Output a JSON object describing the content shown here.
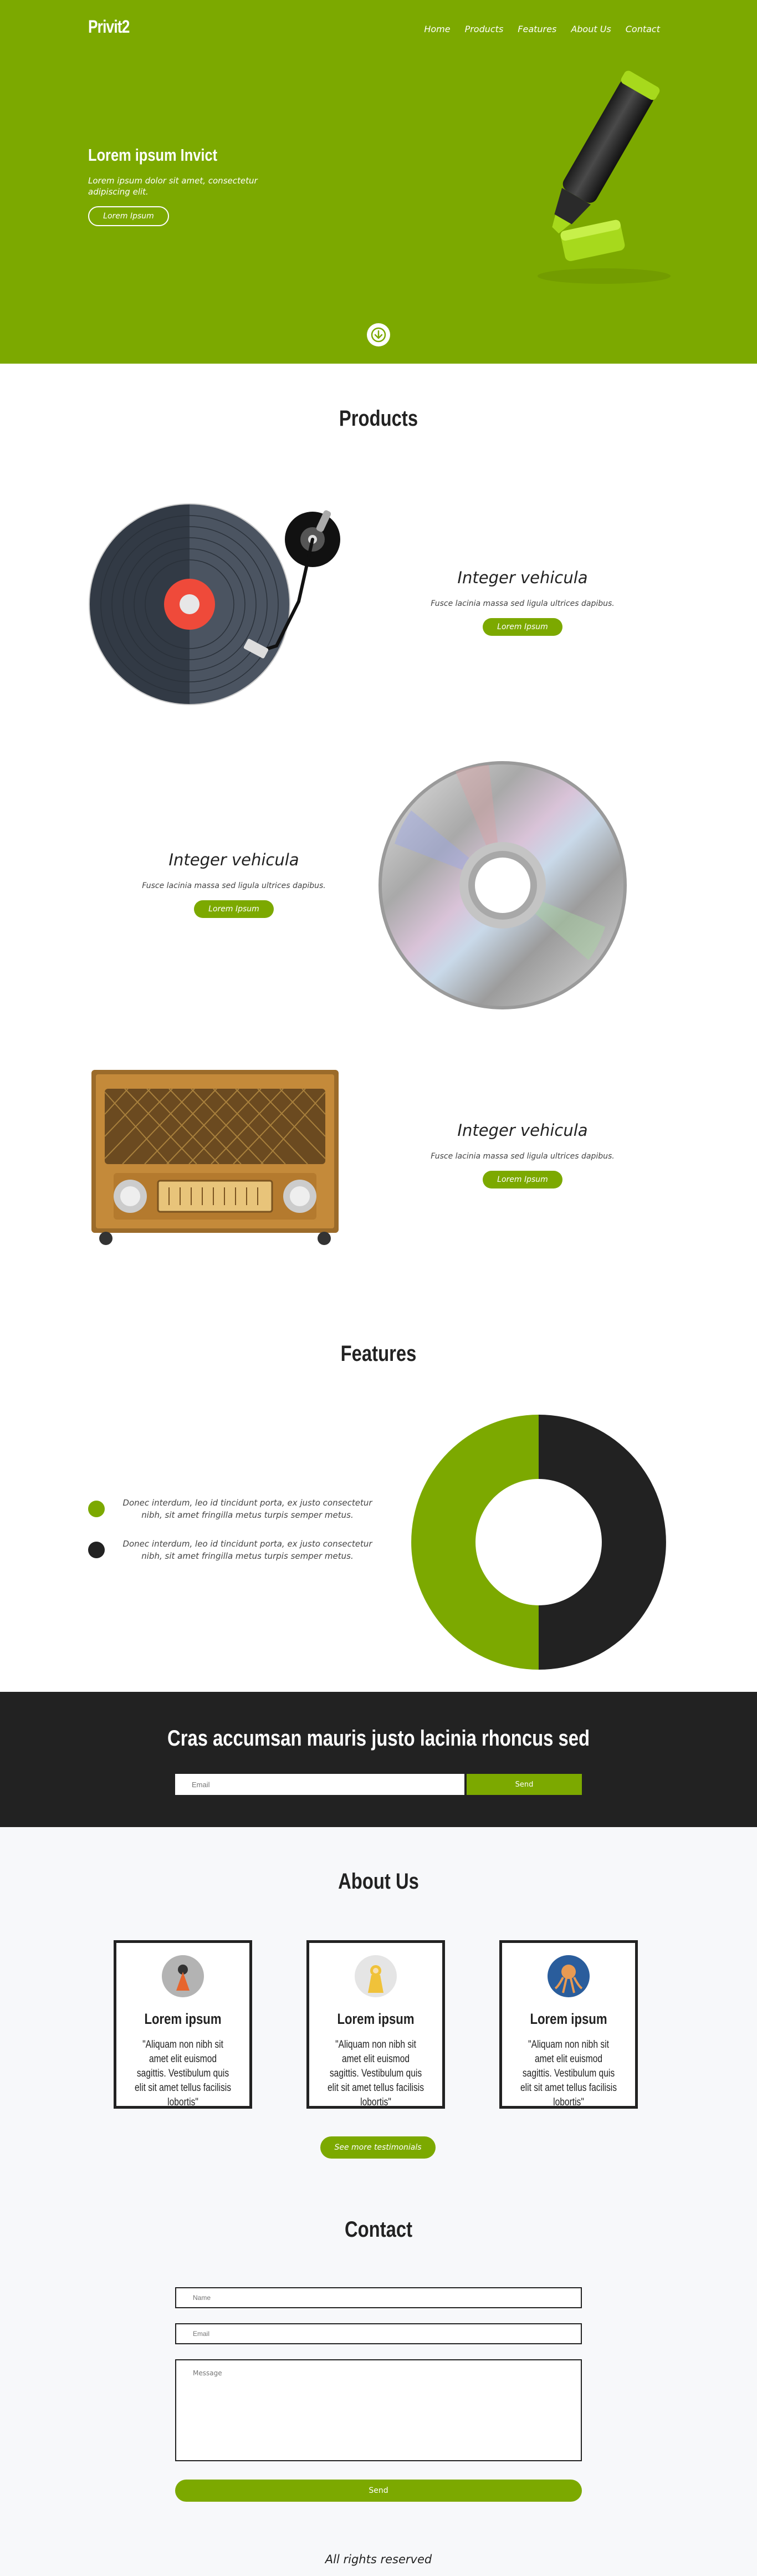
{
  "brand": "Privit2",
  "colors": {
    "accent": "#7ca900",
    "dark": "#222222",
    "light_bg": "#f7f8fa"
  },
  "nav": [
    "Home",
    "Products",
    "Features",
    "About Us",
    "Contact"
  ],
  "hero": {
    "title": "Lorem ipsum Invict",
    "text": "Lorem ipsum dolor sit amet, consectetur adipiscing elit.",
    "button": "Lorem Ipsum",
    "illustration_icon": "highlighter-marker-icon",
    "scroll_icon": "arrow-down-circle-icon"
  },
  "products": {
    "title": "Products",
    "items": [
      {
        "heading": "Integer vehicula",
        "text": "Fusce lacinia massa sed ligula ultrices dapibus.",
        "button": "Lorem Ipsum",
        "image_icon": "turntable-icon"
      },
      {
        "heading": "Integer vehicula",
        "text": "Fusce lacinia massa sed ligula ultrices dapibus.",
        "button": "Lorem Ipsum",
        "image_icon": "compact-disc-icon"
      },
      {
        "heading": "Integer vehicula",
        "text": "Fusce lacinia massa sed ligula ultrices dapibus.",
        "button": "Lorem Ipsum",
        "image_icon": "vintage-radio-icon"
      }
    ]
  },
  "features": {
    "title": "Features",
    "items": [
      {
        "text": "Donec interdum, leo id tincidunt porta, ex justo consectetur nibh, sit amet fringilla metus turpis semper metus.",
        "color": "#7ca900"
      },
      {
        "text": "Donec interdum, leo id tincidunt porta, ex justo consectetur nibh, sit amet fringilla metus turpis semper metus.",
        "color": "#222222"
      }
    ],
    "donut": {
      "share_green": 0.5,
      "share_dark": 0.5
    }
  },
  "cta": {
    "title": "Cras accumsan mauris justo lacinia rhoncus sed",
    "email_placeholder": "Email",
    "button": "Send"
  },
  "about": {
    "title": "About Us",
    "cards": [
      {
        "name": "Lorem ipsum",
        "quote": "\"Aliquam non nibh sit amet elit euismod sagittis. Vestibulum quis elit sit amet tellus facilisis lobortis\"",
        "avatar_icon": "avatar-orange-figure-icon"
      },
      {
        "name": "Lorem ipsum",
        "quote": "\"Aliquam non nibh sit amet elit euismod sagittis. Vestibulum quis elit sit amet tellus facilisis lobortis\"",
        "avatar_icon": "avatar-yellow-raincoat-icon"
      },
      {
        "name": "Lorem ipsum",
        "quote": "\"Aliquam non nibh sit amet elit euismod sagittis. Vestibulum quis elit sit amet tellus facilisis lobortis\"",
        "avatar_icon": "avatar-octopus-icon"
      }
    ],
    "more_button": "See more testimonials"
  },
  "contact": {
    "title": "Contact",
    "name_placeholder": "Name",
    "email_placeholder": "Email",
    "message_placeholder": "Message",
    "button": "Send"
  },
  "footer": "All rights reserved"
}
